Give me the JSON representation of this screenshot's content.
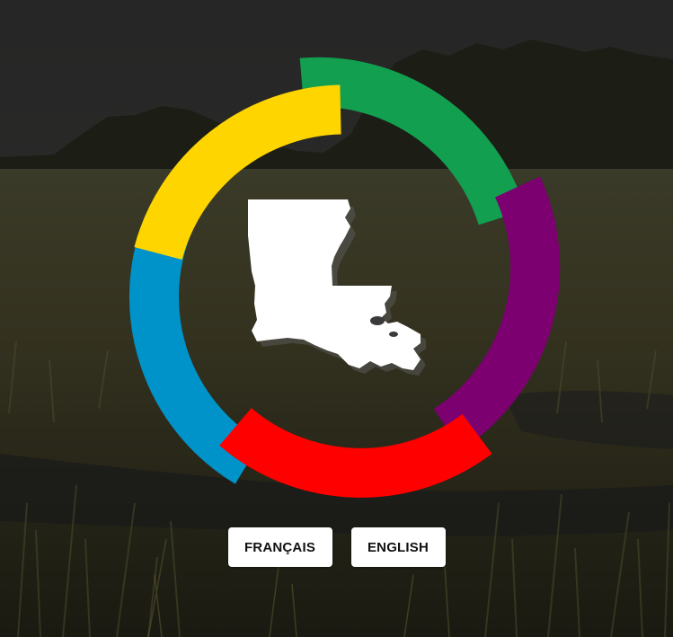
{
  "background": {
    "scene": "marsh-grass-at-dusk",
    "overlay_color": "#1b1b1b"
  },
  "logo": {
    "icon": "louisiana-state-silhouette-icon",
    "ring_colors": {
      "green": "#12a050",
      "purple": "#7d0071",
      "red": "#ff0000",
      "blue": "#0093c9",
      "yellow": "#ffd500"
    },
    "state_fill": "#ffffff"
  },
  "language_buttons": {
    "french_label": "FRANÇAIS",
    "english_label": "ENGLISH"
  }
}
